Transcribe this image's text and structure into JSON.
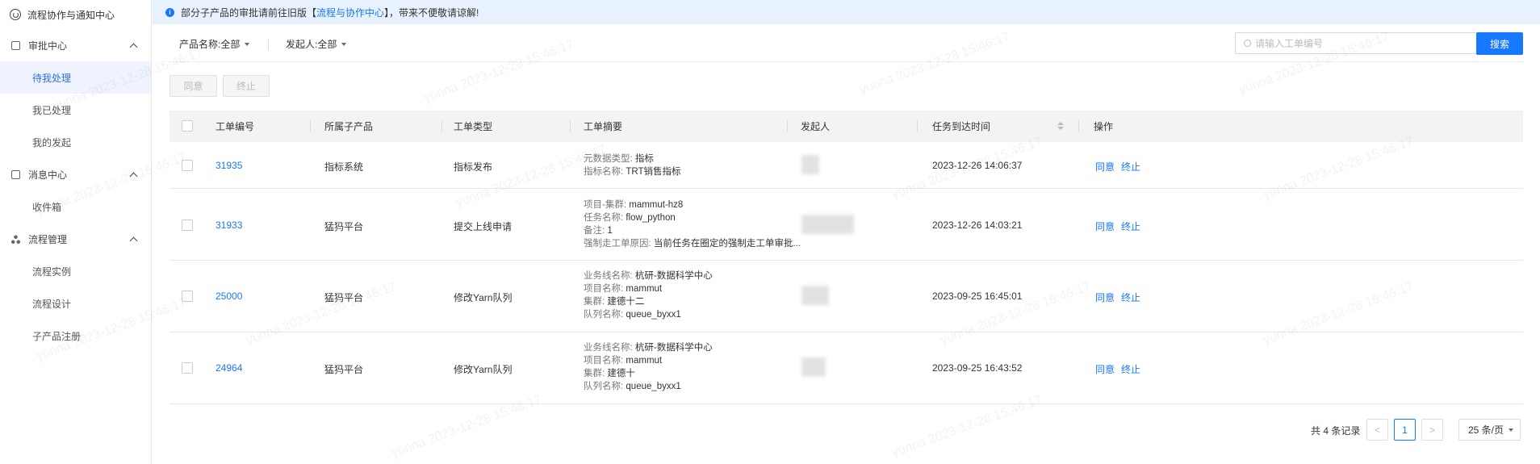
{
  "app": {
    "title": "流程协作与通知中心"
  },
  "sidebar": {
    "groups": [
      {
        "label": "审批中心",
        "items": [
          "待我处理",
          "我已处理",
          "我的发起"
        ]
      },
      {
        "label": "消息中心",
        "items": [
          "收件箱"
        ]
      },
      {
        "label": "流程管理",
        "items": [
          "流程实例",
          "流程设计",
          "子产品注册"
        ]
      }
    ],
    "active_item": "待我处理"
  },
  "notice": {
    "prefix": "部分子产品的审批请前往旧版【",
    "link": "流程与协作中心",
    "suffix": "】，带来不便敬请谅解!"
  },
  "filters": {
    "product": "产品名称:全部",
    "initiator": "发起人:全部"
  },
  "search": {
    "placeholder": "请输入工单编号",
    "value": "",
    "button": "搜索"
  },
  "actions": {
    "approve": "同意",
    "terminate": "终止"
  },
  "table": {
    "columns": [
      "工单编号",
      "所属子产品",
      "工单类型",
      "工单摘要",
      "发起人",
      "任务到达时间",
      "操作"
    ],
    "rows": [
      {
        "id": "31935",
        "product": "指标系统",
        "type": "指标发布",
        "summary": [
          [
            "元数据类型:",
            "指标"
          ],
          [
            "指标名称:",
            "TRT销售指标"
          ]
        ],
        "time": "2023-12-26 14:06:37",
        "ops": [
          "同意",
          "终止"
        ]
      },
      {
        "id": "31933",
        "product": "猛犸平台",
        "type": "提交上线申请",
        "summary": [
          [
            "项目-集群:",
            "mammut-hz8"
          ],
          [
            "任务名称:",
            "flow_python"
          ],
          [
            "备注:",
            "1"
          ],
          [
            "强制走工单原因:",
            "当前任务在圈定的强制走工单审批..."
          ]
        ],
        "time": "2023-12-26 14:03:21",
        "ops": [
          "同意",
          "终止"
        ]
      },
      {
        "id": "25000",
        "product": "猛犸平台",
        "type": "修改Yarn队列",
        "summary": [
          [
            "业务线名称:",
            "杭研-数据科学中心"
          ],
          [
            "项目名称:",
            "mammut"
          ],
          [
            "集群:",
            "建德十二"
          ],
          [
            "队列名称:",
            "queue_byxx1"
          ]
        ],
        "time": "2023-09-25 16:45:01",
        "ops": [
          "同意",
          "终止"
        ]
      },
      {
        "id": "24964",
        "product": "猛犸平台",
        "type": "修改Yarn队列",
        "summary": [
          [
            "业务线名称:",
            "杭研-数据科学中心"
          ],
          [
            "项目名称:",
            "mammut"
          ],
          [
            "集群:",
            "建德十"
          ],
          [
            "队列名称:",
            "queue_byxx1"
          ]
        ],
        "time": "2023-09-25 16:43:52",
        "ops": [
          "同意",
          "终止"
        ]
      }
    ]
  },
  "pagination": {
    "total": "共 4 条记录",
    "current_page": "1",
    "page_size": "25 条/页",
    "prev": "<",
    "next": ">"
  },
  "watermark": "yunna 2023-12-28 15:46:17",
  "colors": {
    "accent": "#1677ff",
    "notice_bg": "#e8f2fe",
    "active_bg": "#eef3fe"
  }
}
